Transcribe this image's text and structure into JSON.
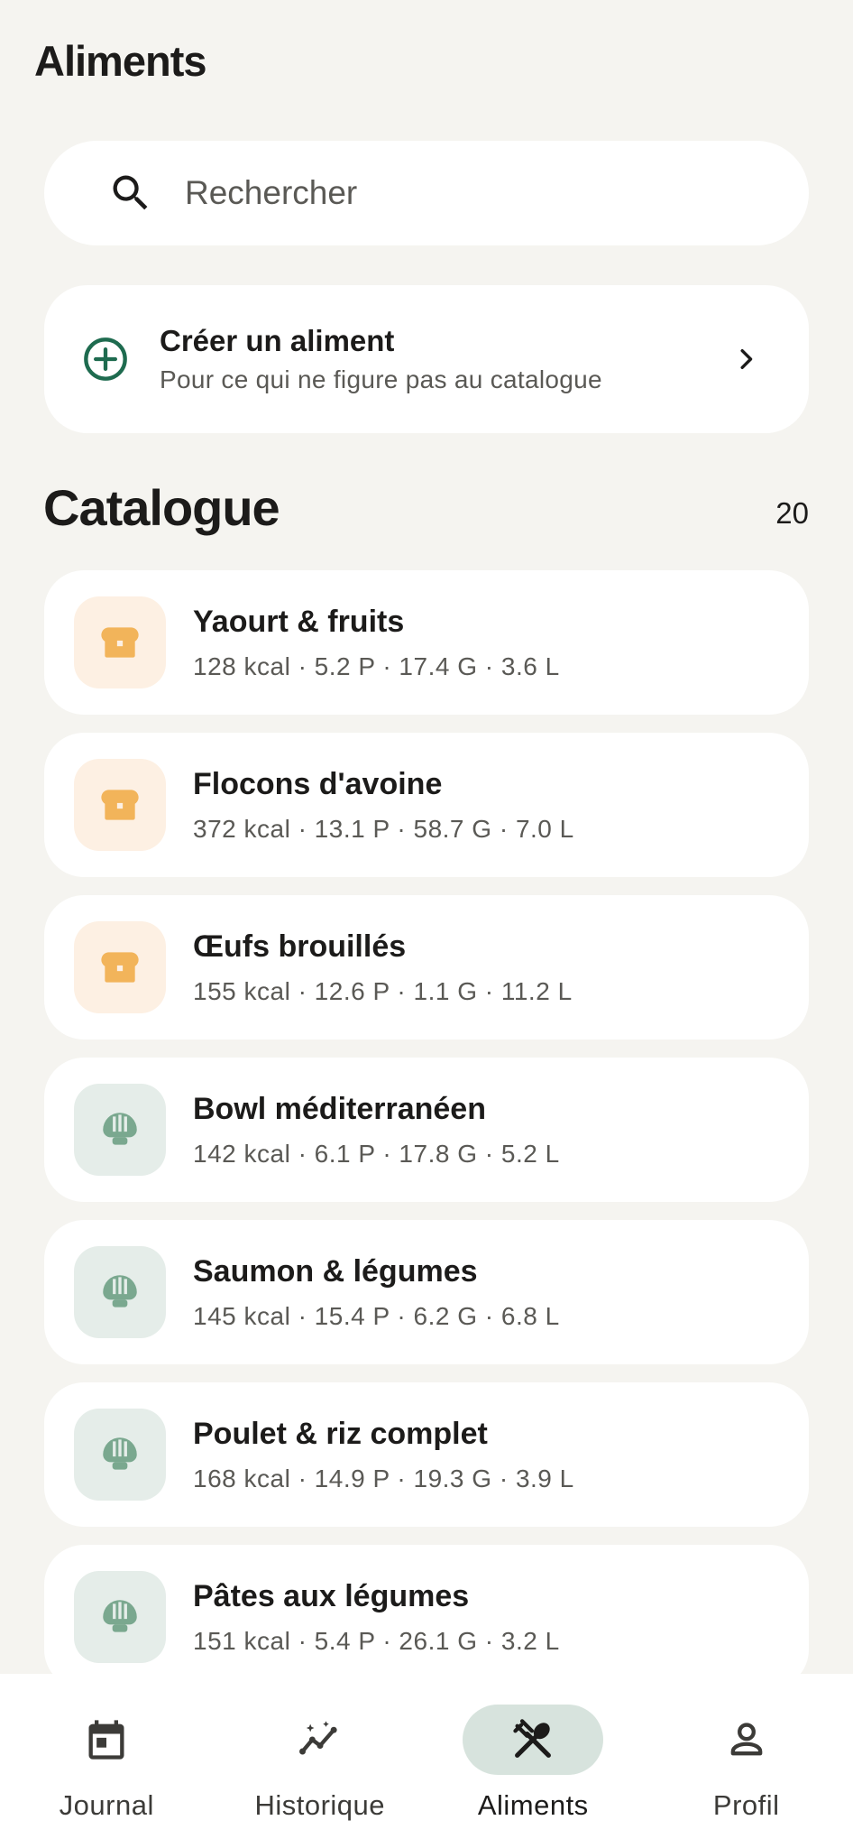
{
  "header": {
    "title": "Aliments"
  },
  "search": {
    "placeholder": "Rechercher"
  },
  "create": {
    "title": "Créer un aliment",
    "subtitle": "Pour ce qui ne figure pas au catalogue"
  },
  "catalogue": {
    "title": "Catalogue",
    "count": "20",
    "items": [
      {
        "name": "Yaourt & fruits",
        "macros": "128 kcal · 5.2 P · 17.4 G · 3.6 L",
        "icon": "bread-icon"
      },
      {
        "name": "Flocons d'avoine",
        "macros": "372 kcal · 13.1 P · 58.7 G · 7.0 L",
        "icon": "bread-icon"
      },
      {
        "name": "Œufs brouillés",
        "macros": "155 kcal · 12.6 P · 1.1 G · 11.2 L",
        "icon": "bread-icon"
      },
      {
        "name": "Bowl méditerranéen",
        "macros": "142 kcal · 6.1 P · 17.8 G · 5.2 L",
        "icon": "rice-bowl-icon"
      },
      {
        "name": "Saumon & légumes",
        "macros": "145 kcal · 15.4 P · 6.2 G · 6.8 L",
        "icon": "rice-bowl-icon"
      },
      {
        "name": "Poulet & riz complet",
        "macros": "168 kcal · 14.9 P · 19.3 G · 3.9 L",
        "icon": "rice-bowl-icon"
      },
      {
        "name": "Pâtes aux légumes",
        "macros": "151 kcal · 5.4 P · 26.1 G · 3.2 L",
        "icon": "rice-bowl-icon"
      }
    ]
  },
  "nav": {
    "items": [
      {
        "label": "Journal",
        "icon": "calendar-icon"
      },
      {
        "label": "Historique",
        "icon": "insights-icon"
      },
      {
        "label": "Aliments",
        "icon": "restaurant-icon",
        "active": true
      },
      {
        "label": "Profil",
        "icon": "person-icon"
      }
    ]
  },
  "colors": {
    "background": "#f5f4f0",
    "accent_green": "#1e6b4f",
    "bread_icon": "#f2b45a",
    "bread_bg": "#fdf0e3",
    "bowl_icon": "#7aa88f",
    "bowl_bg": "#e5ede9",
    "active_pill": "#d7e3dd"
  }
}
